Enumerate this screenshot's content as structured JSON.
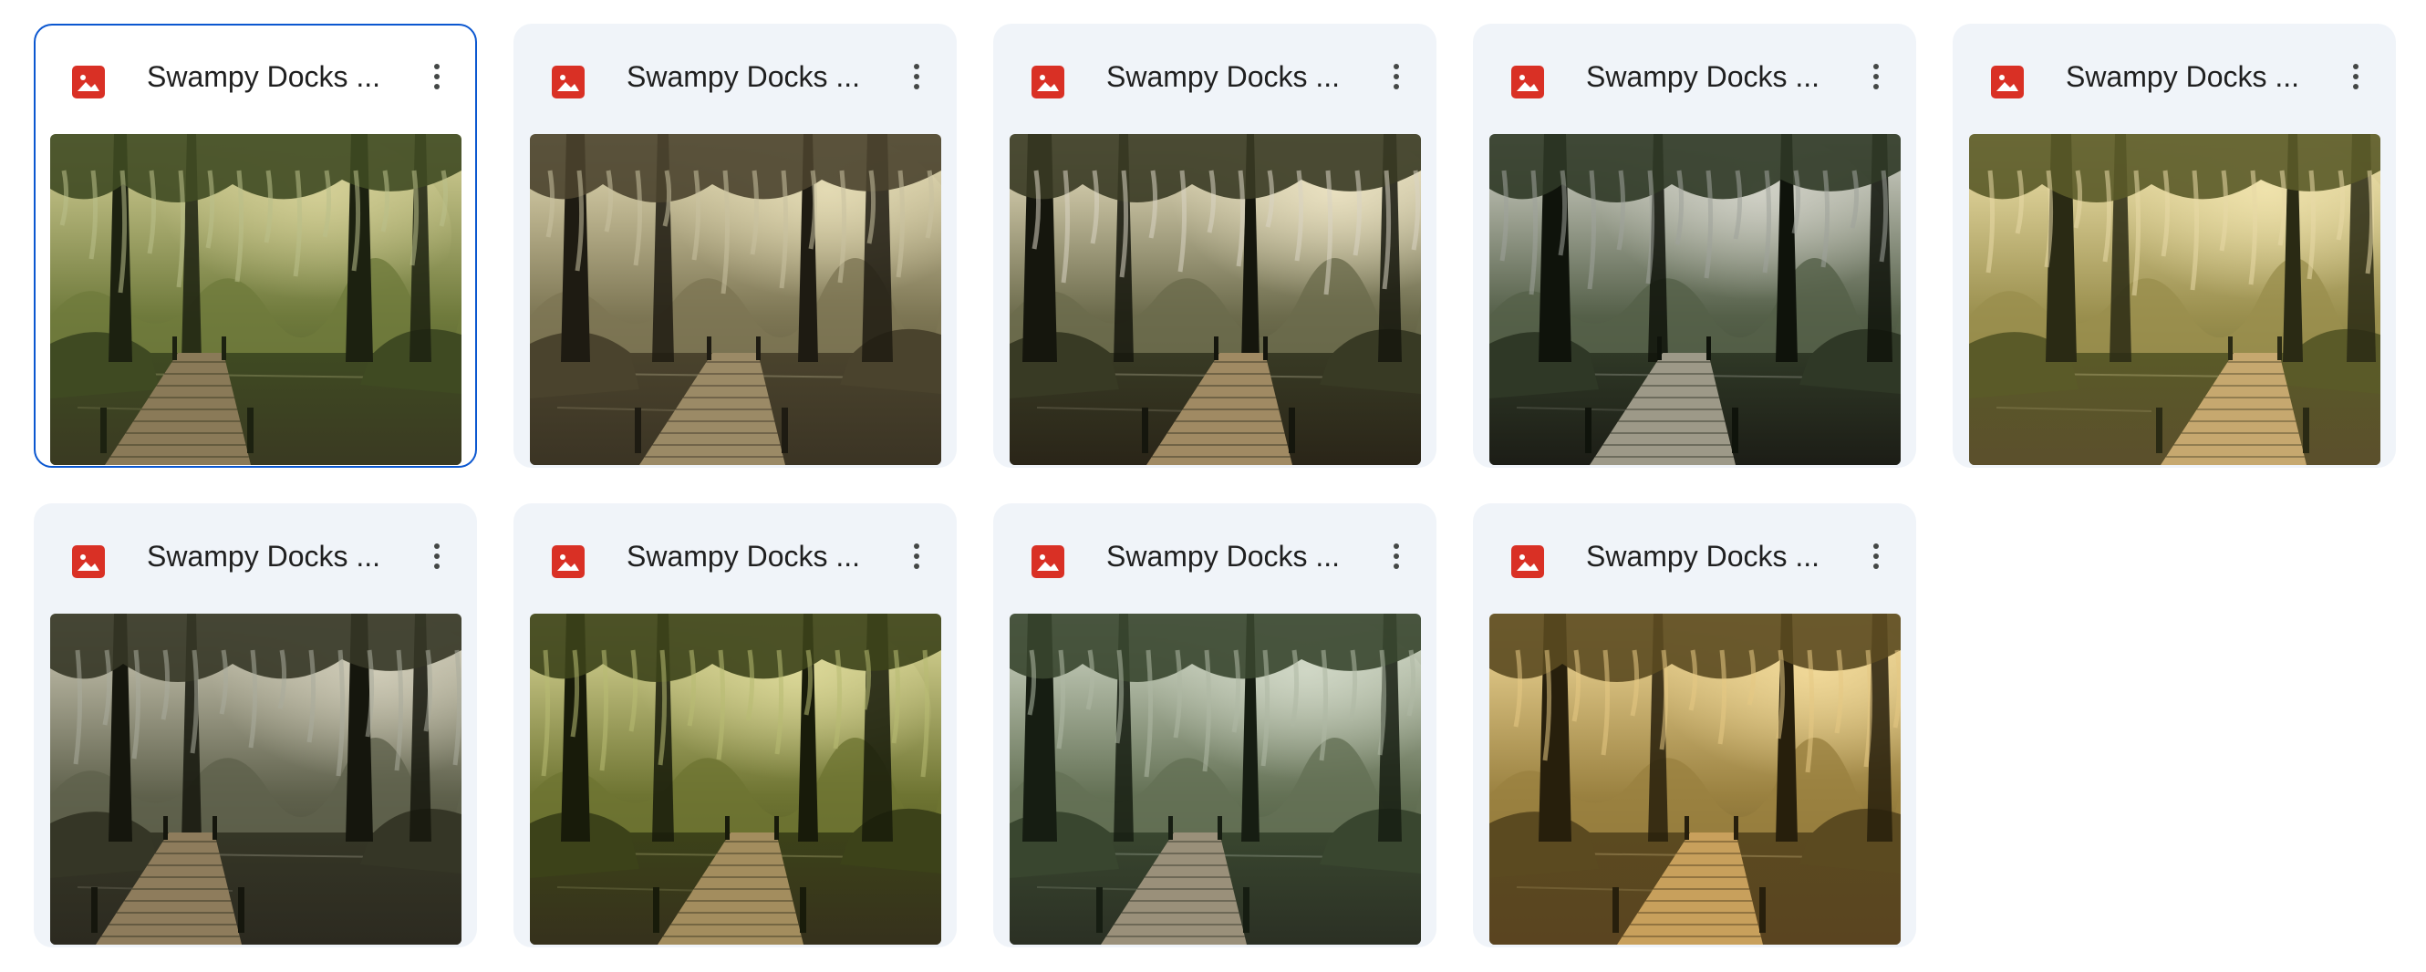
{
  "colors": {
    "selected_border": "#0b57d0",
    "card_background": "#f0f4f9",
    "image_file_icon": "#d93025"
  },
  "files": [
    {
      "name": "Swampy Docks ...",
      "icon": "image-file-icon",
      "selected": true,
      "variant": 0
    },
    {
      "name": "Swampy Docks ...",
      "icon": "image-file-icon",
      "selected": false,
      "variant": 1
    },
    {
      "name": "Swampy Docks ...",
      "icon": "image-file-icon",
      "selected": false,
      "variant": 2
    },
    {
      "name": "Swampy Docks ...",
      "icon": "image-file-icon",
      "selected": false,
      "variant": 3
    },
    {
      "name": "Swampy Docks ...",
      "icon": "image-file-icon",
      "selected": false,
      "variant": 4
    },
    {
      "name": "Swampy Docks ...",
      "icon": "image-file-icon",
      "selected": false,
      "variant": 5
    },
    {
      "name": "Swampy Docks ...",
      "icon": "image-file-icon",
      "selected": false,
      "variant": 6
    },
    {
      "name": "Swampy Docks ...",
      "icon": "image-file-icon",
      "selected": false,
      "variant": 7
    },
    {
      "name": "Swampy Docks ...",
      "icon": "image-file-icon",
      "selected": false,
      "variant": 8
    }
  ]
}
